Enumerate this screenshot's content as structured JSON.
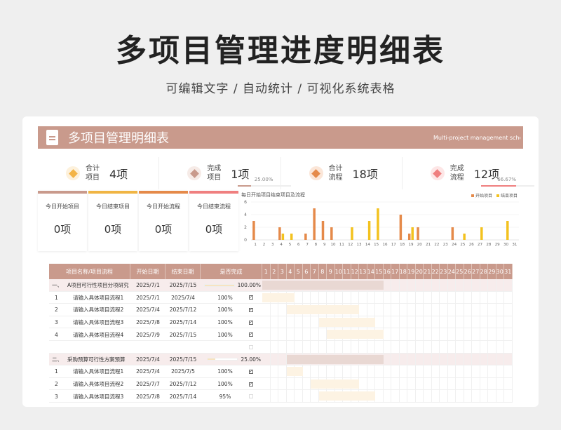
{
  "page": {
    "title": "多项目管理进度明细表",
    "subtitle": "可编辑文字  /  自动统计  /  可视化系统表格"
  },
  "banner": {
    "title": "多项目管理明细表",
    "english": "Multi-project management schedule"
  },
  "kpis": [
    {
      "label": "合计项目",
      "value": "4项",
      "pct": "",
      "fill": 0,
      "color": "#f3b447",
      "bg": "#fdf1dc"
    },
    {
      "label": "完成项目",
      "value": "1项",
      "pct": "25.00%",
      "fill": 0.25,
      "color": "#c99a8c",
      "bg": "#f6ebe7"
    },
    {
      "label": "合计流程",
      "value": "18项",
      "pct": "",
      "fill": 0,
      "color": "#e58a4a",
      "bg": "#fbe6d8"
    },
    {
      "label": "完成流程",
      "value": "12项",
      "pct": "66.67%",
      "fill": 0.6667,
      "color": "#ef7f7f",
      "bg": "#fde6e6"
    }
  ],
  "stat_boxes": [
    {
      "label": "今日开始项目",
      "value": "0项",
      "color": "#c99a8c"
    },
    {
      "label": "今日结束项目",
      "value": "0项",
      "color": "#f0b544"
    },
    {
      "label": "今日开始流程",
      "value": "0项",
      "color": "#e58a4a"
    },
    {
      "label": "今日结束流程",
      "value": "0项",
      "color": "#ef7f7f"
    }
  ],
  "chart_data": {
    "type": "bar",
    "title": "每日开始项目结束项目及流程",
    "ylim": [
      0,
      6
    ],
    "yticks": [
      0,
      2,
      4,
      6
    ],
    "categories": [
      "1",
      "2",
      "3",
      "4",
      "5",
      "6",
      "7",
      "8",
      "9",
      "10",
      "11",
      "12",
      "13",
      "14",
      "15",
      "16",
      "17",
      "18",
      "19",
      "20",
      "21",
      "22",
      "23",
      "24",
      "25",
      "26",
      "27",
      "28",
      "29",
      "30",
      "31"
    ],
    "series": [
      {
        "name": "开始项目",
        "color": "#e58a4a",
        "values": [
          3,
          0,
          0,
          2,
          0,
          0,
          1,
          5,
          3,
          2,
          0,
          0,
          0,
          0,
          0,
          0,
          0,
          4,
          1,
          2,
          0,
          0,
          0,
          2,
          0,
          0,
          0,
          0,
          0,
          0,
          0
        ]
      },
      {
        "name": "结束项目",
        "color": "#f3c21f",
        "values": [
          0,
          0,
          0,
          1,
          1,
          0,
          0,
          0,
          0,
          0,
          0,
          2,
          0,
          3,
          5,
          0,
          0,
          0,
          2,
          0,
          0,
          0,
          0,
          0,
          1,
          0,
          2,
          0,
          0,
          3,
          0
        ]
      }
    ],
    "grid": true,
    "legend": "top-right"
  },
  "table": {
    "headers": [
      "项目名称/项目流程",
      "开始日期",
      "结束日期",
      "是否完成"
    ],
    "days": [
      "1",
      "2",
      "3",
      "4",
      "5",
      "6",
      "7",
      "8",
      "9",
      "10",
      "11",
      "12",
      "13",
      "14",
      "15",
      "16",
      "17",
      "18",
      "19",
      "20",
      "21",
      "22",
      "23",
      "24",
      "25",
      "26",
      "27",
      "28",
      "29",
      "30",
      "31"
    ],
    "rows": [
      {
        "type": "cat",
        "no": "一、",
        "name": "A项目可行性项目分项研究",
        "start": "2025/7/1",
        "end": "2025/7/15",
        "pct": "100.00%",
        "progress": 1.0,
        "gantt": [
          1,
          15
        ]
      },
      {
        "type": "item",
        "no": "1",
        "name": "请输入具体项目流程1",
        "start": "2025/7/1",
        "end": "2025/7/4",
        "pct": "100%",
        "done": true,
        "gantt": [
          1,
          4
        ]
      },
      {
        "type": "item",
        "no": "2",
        "name": "请输入具体项目流程2",
        "start": "2025/7/4",
        "end": "2025/7/12",
        "pct": "100%",
        "done": true,
        "gantt": [
          4,
          12
        ]
      },
      {
        "type": "item",
        "no": "3",
        "name": "请输入具体项目流程3",
        "start": "2025/7/8",
        "end": "2025/7/14",
        "pct": "100%",
        "done": true,
        "gantt": [
          8,
          14
        ]
      },
      {
        "type": "item",
        "no": "4",
        "name": "请输入具体项目流程4",
        "start": "2025/7/9",
        "end": "2025/7/15",
        "pct": "100%",
        "done": true,
        "gantt": [
          9,
          15
        ]
      },
      {
        "type": "empty",
        "no": "",
        "name": "",
        "start": "",
        "end": "",
        "pct": "",
        "done": false,
        "gantt": null
      },
      {
        "type": "cat",
        "no": "二、",
        "name": "采购预算可行性方案预算",
        "start": "2025/7/4",
        "end": "2025/7/15",
        "pct": "25.00%",
        "progress": 0.25,
        "gantt": [
          4,
          15
        ]
      },
      {
        "type": "item",
        "no": "1",
        "name": "请输入具体项目流程1",
        "start": "2025/7/4",
        "end": "2025/7/5",
        "pct": "100%",
        "done": true,
        "gantt": [
          4,
          5
        ]
      },
      {
        "type": "item",
        "no": "2",
        "name": "请输入具体项目流程2",
        "start": "2025/7/7",
        "end": "2025/7/12",
        "pct": "100%",
        "done": true,
        "gantt": [
          7,
          12
        ]
      },
      {
        "type": "item",
        "no": "3",
        "name": "请输入具体项目流程3",
        "start": "2025/7/8",
        "end": "2025/7/14",
        "pct": "95%",
        "done": false,
        "gantt": [
          8,
          14
        ]
      }
    ]
  }
}
